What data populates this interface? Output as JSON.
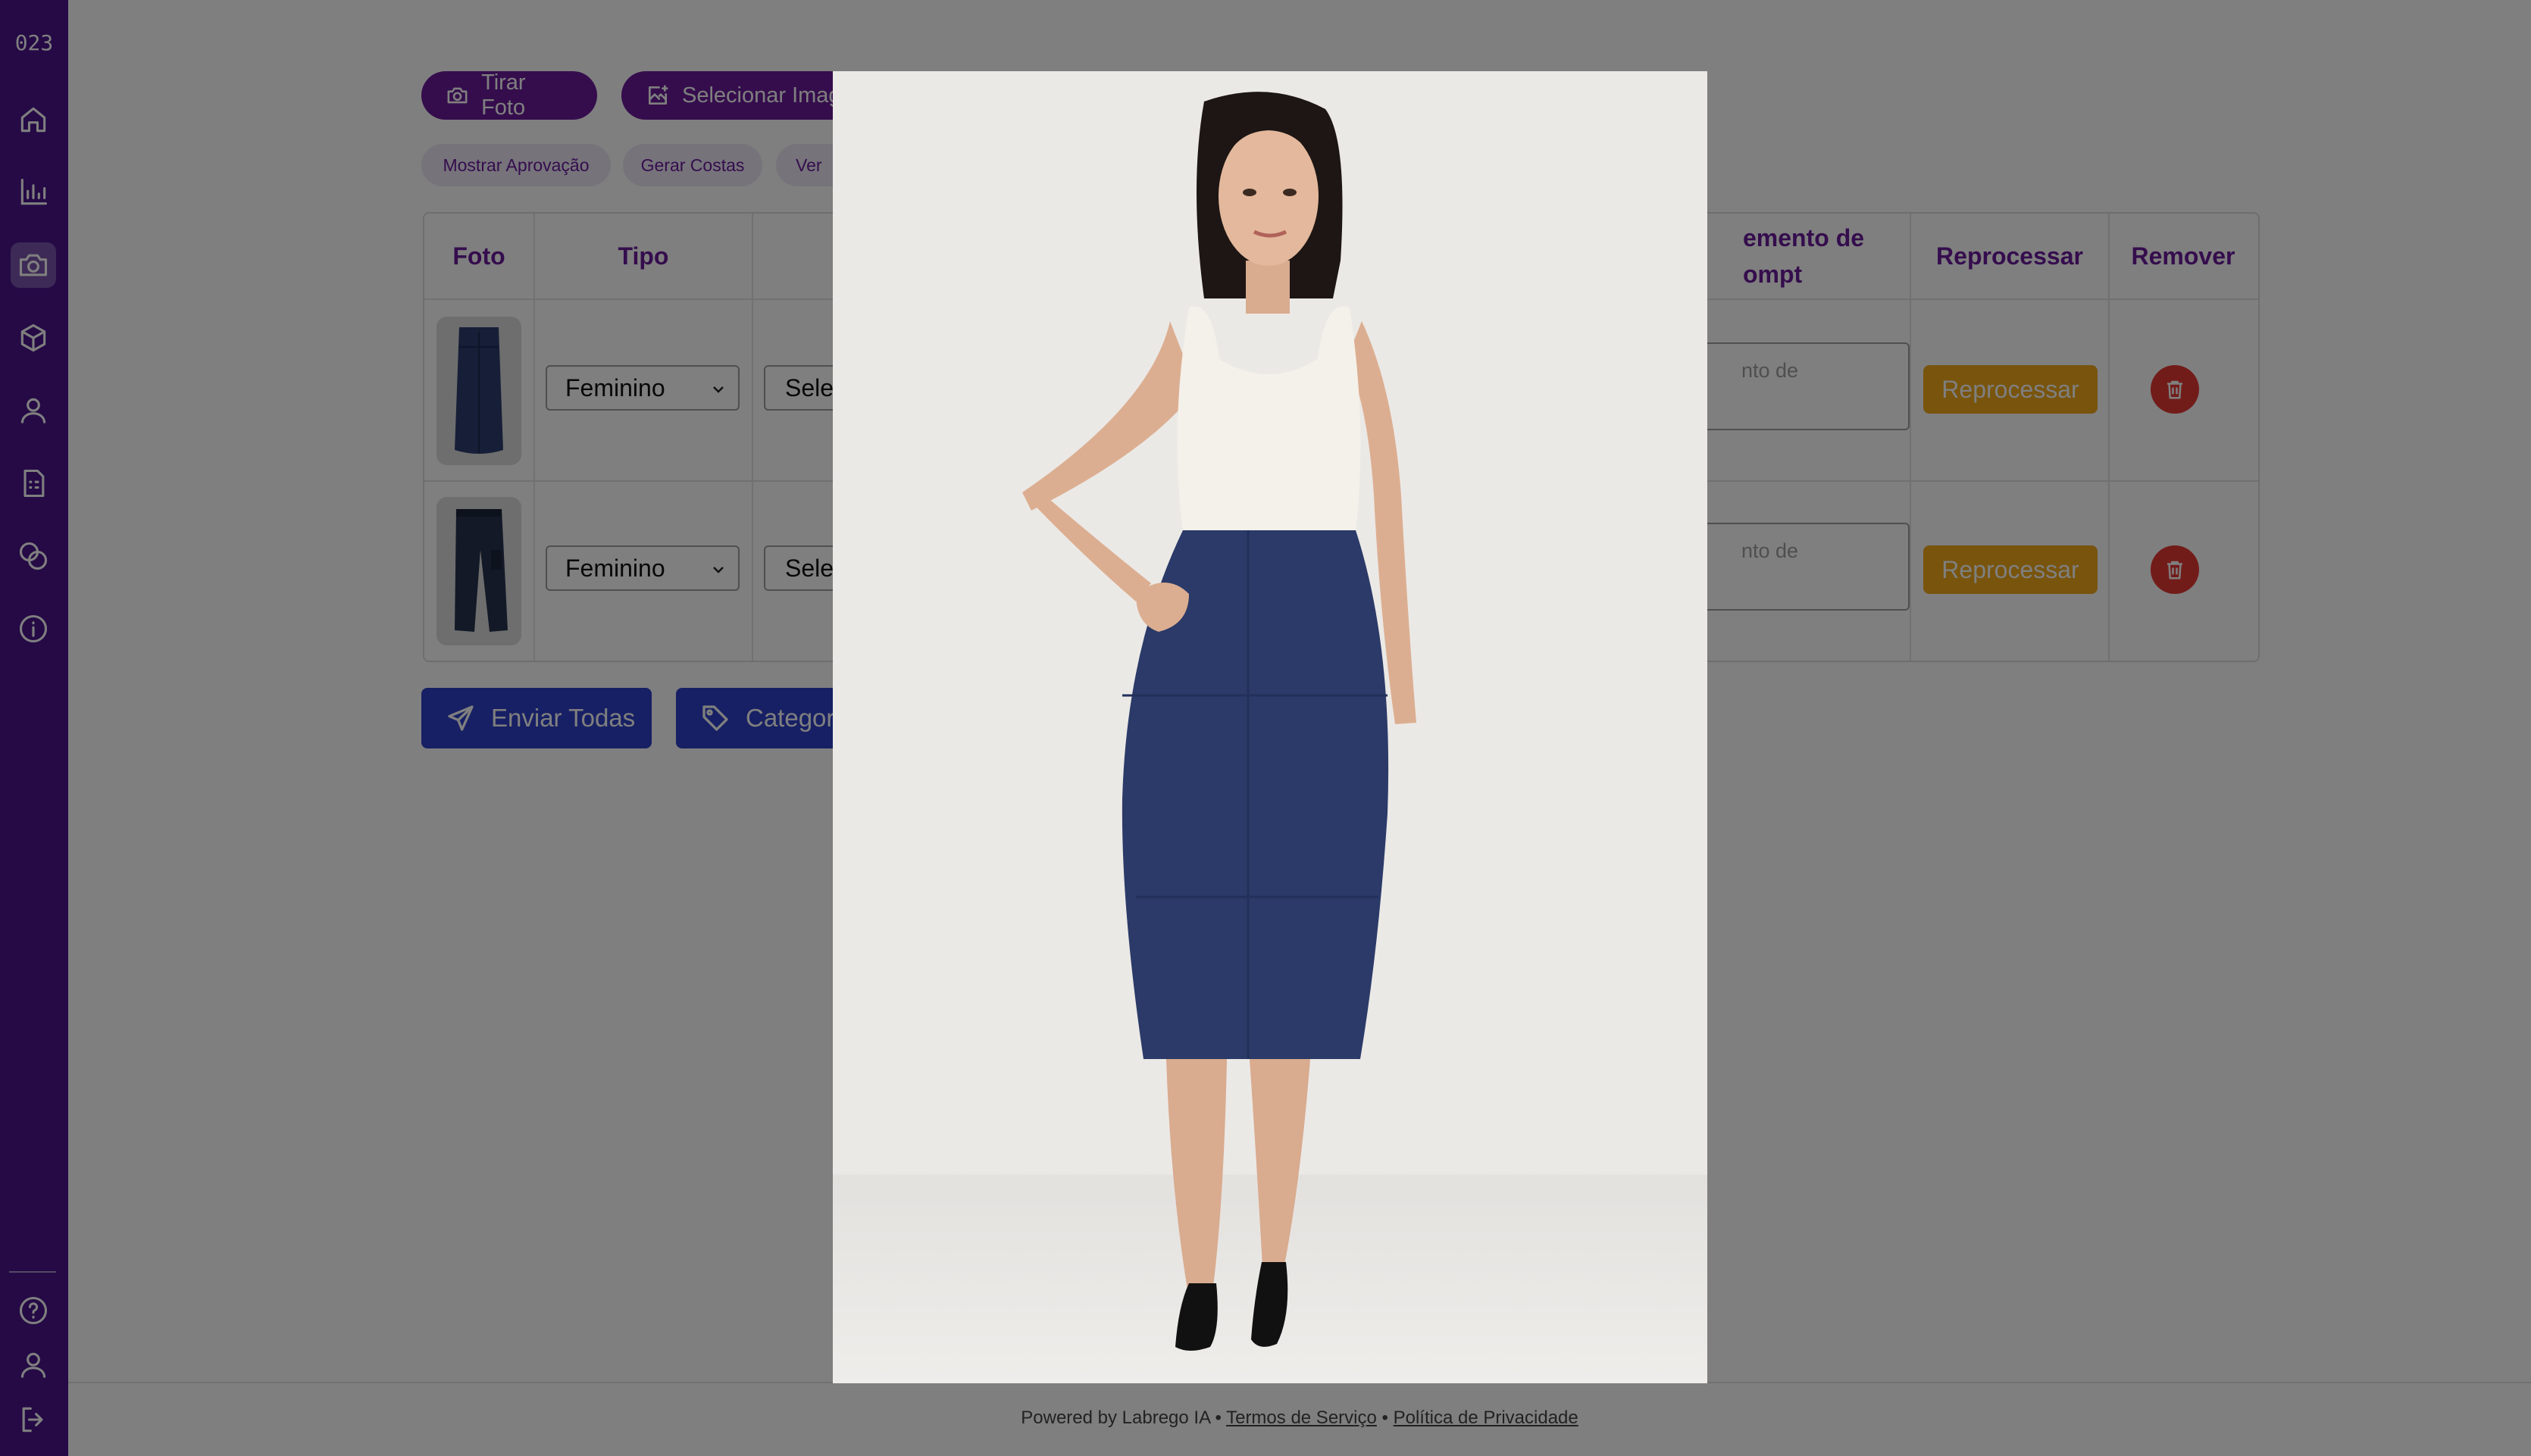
{
  "sidebar": {
    "logo": "023",
    "nav": [
      {
        "name": "home-icon",
        "active": false
      },
      {
        "name": "bar-chart-icon",
        "active": false
      },
      {
        "name": "camera-icon",
        "active": true
      },
      {
        "name": "box-icon",
        "active": false
      },
      {
        "name": "user-icon",
        "active": false
      },
      {
        "name": "document-icon",
        "active": false
      },
      {
        "name": "coins-icon",
        "active": false
      },
      {
        "name": "info-icon",
        "active": false
      }
    ],
    "bottom": [
      {
        "name": "help-icon"
      },
      {
        "name": "profile-icon"
      },
      {
        "name": "logout-icon"
      }
    ],
    "color": "#4a148c"
  },
  "toolbar": {
    "take_photo": "Tirar Foto",
    "select_image": "Selecionar Imag"
  },
  "chips": {
    "show_approval": "Mostrar Aprovação",
    "generate_back": "Gerar Costas",
    "see": "Ver"
  },
  "table": {
    "headers": {
      "photo": "Foto",
      "type": "Tipo",
      "prompt_line1": "emento de",
      "prompt_line2": "ompt",
      "reprocess": "Reprocessar",
      "remove": "Remover"
    },
    "rows": [
      {
        "thumb": "skirt-thumbnail",
        "type": "Feminino",
        "select_value": "Sele",
        "prompt_placeholder": "nto de",
        "reprocess_label": "Reprocessar"
      },
      {
        "thumb": "pants-thumbnail",
        "type": "Feminino",
        "select_value": "Sele",
        "prompt_placeholder": "nto de",
        "reprocess_label": "Reprocessar"
      }
    ]
  },
  "actions": {
    "send_all": "Enviar Todas",
    "categorize": "Categori"
  },
  "footer": {
    "powered": "Powered by Labrego IA",
    "sep": "•",
    "terms": "Termos de Serviço",
    "privacy": "Política de Privacidade"
  },
  "colors": {
    "accent_purple": "#6a1b9a",
    "reprocess": "#f0a81a",
    "remove": "#e53935",
    "primary_blue": "#2f40c8"
  }
}
